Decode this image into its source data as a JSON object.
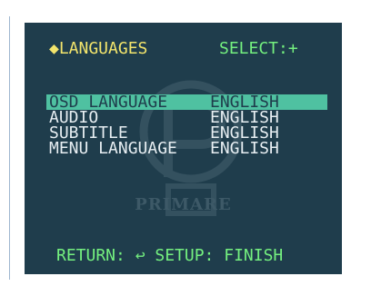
{
  "header": {
    "title": "◆LANGUAGES",
    "select_hint": "SELECT:+"
  },
  "menu": {
    "items": [
      {
        "label": "OSD LANGUAGE",
        "value": "ENGLISH",
        "selected": true
      },
      {
        "label": "AUDIO",
        "value": "ENGLISH",
        "selected": false
      },
      {
        "label": "SUBTITLE",
        "value": "ENGLISH",
        "selected": false
      },
      {
        "label": "MENU LANGUAGE",
        "value": "ENGLISH",
        "selected": false
      }
    ]
  },
  "watermark": {
    "text": "PRIMARE"
  },
  "footer": {
    "text": "RETURN: ↩ SETUP: FINISH"
  },
  "colors": {
    "background": "#1f3d4c",
    "title": "#f3e56c",
    "accent_green": "#74f07f",
    "highlight": "#4fc1a1",
    "text": "#e7eef2"
  }
}
